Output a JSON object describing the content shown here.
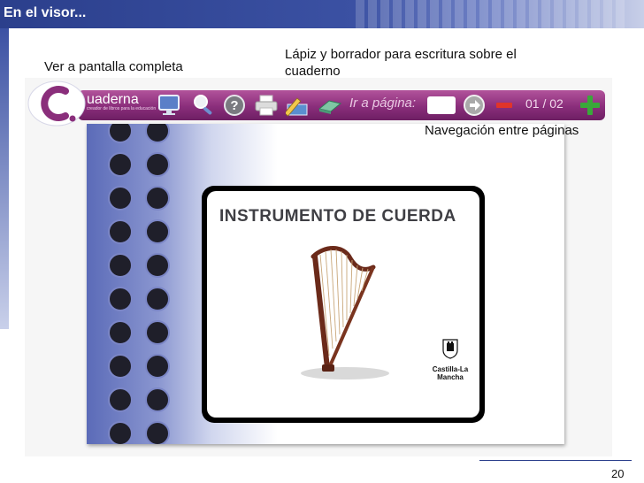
{
  "slide": {
    "title": "En el visor...",
    "page_number": "20"
  },
  "annotations": {
    "fullscreen": "Ver a pantalla completa",
    "pencil_line1": "Lápiz y borrador para escritura sobre el",
    "pencil_line2": "cuaderno",
    "navigation": "Navegación entre páginas"
  },
  "viewer": {
    "brand_name": "uaderna",
    "brand_tagline": "creador de libros para la educación",
    "toolbar_icons": [
      "monitor-icon",
      "magnifier-icon",
      "help-icon",
      "printer-icon",
      "pencil-icon",
      "eraser-icon",
      "next-arrow-icon",
      "minus-icon",
      "plus-icon"
    ],
    "goto_label": "Ir a página:",
    "goto_value": "",
    "page_counter": "01 / 02",
    "colors": {
      "toolbar": "#8a2e7b",
      "next_button": "#a9a9a9",
      "minus_button": "#e0342a",
      "plus_button": "#3aa83a"
    }
  },
  "document": {
    "card_title": "INSTRUMENTO DE CUERDA",
    "image": "harp",
    "logo_text": "Castilla-La Mancha"
  }
}
